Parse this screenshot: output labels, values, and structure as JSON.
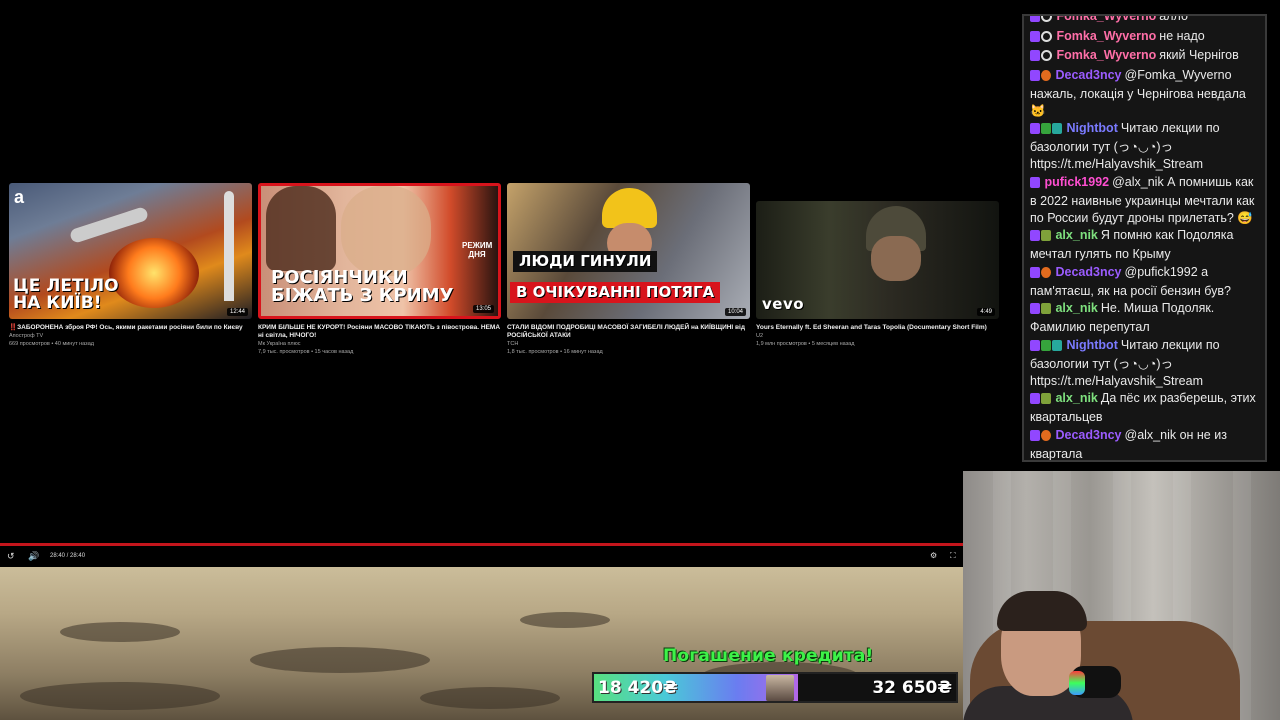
{
  "videos": [
    {
      "title": "‼️ЗАБОРОНЕНА зброя РФ! Ось, якими ракетами росіяни били по Києву",
      "channel": "Апостроф TV",
      "meta": "669 просмотров • 40 минут назад",
      "duration": "12:44",
      "overlay": "ЦЕ ЛЕТІЛО\nНА КИЇВ!"
    },
    {
      "title": "КРИМ БІЛЬШЕ НЕ КУРОРТ! Росіяни МАСОВО ТІКАЮТЬ з півострова. НЕМА ні світла, НІЧОГО!",
      "channel": "Мк Україна плюс",
      "meta": "7,9 тыс. просмотров • 15 часов назад",
      "duration": "13:05",
      "overlay": "РОСІЯНЧИКИ\nБІЖАТЬ З КРИМУ",
      "tag": "РЕЖИМ ДНЯ"
    },
    {
      "title": "СТАЛИ ВІДОМІ ПОДРОБИЦІ МАСОВОЇ ЗАГИБЕЛІ ЛЮДЕЙ на КИЇВЩИНІ від РОСІЙСЬКОЇ АТАКИ",
      "channel": "ТСН",
      "meta": "1,8 тыс. просмотров • 16 минут назад",
      "duration": "10:04",
      "overlay_top": "ЛЮДИ ГИНУЛИ",
      "overlay_bottom": "В ОЧІКУВАННІ ПОТЯГА"
    },
    {
      "title": "Yours Eternally ft. Ed Sheeran and Taras Topolia (Documentary Short Film)",
      "channel": "U2",
      "meta": "1,9 млн просмотров • 5 месяцев назад",
      "duration": "4:49",
      "overlay": "vevo"
    }
  ],
  "player": {
    "time": "28:40 / 28:40"
  },
  "credit": {
    "title": "Погашение кредита!",
    "current": "18 420₴",
    "goal": "32 650₴",
    "progress": 0.564
  },
  "chat": [
    {
      "nick": "Fomka_Wyverno",
      "color": "#ff6fa8",
      "badges": [
        "twitch",
        "ring"
      ],
      "text": "алло"
    },
    {
      "nick": "Fomka_Wyverno",
      "color": "#ff6fa8",
      "badges": [
        "twitch",
        "ring"
      ],
      "text": "не надо"
    },
    {
      "nick": "Fomka_Wyverno",
      "color": "#ff6fa8",
      "badges": [
        "twitch",
        "ring"
      ],
      "text": "який Чернігов"
    },
    {
      "nick": "Decad3ncy",
      "color": "#9b5cff",
      "badges": [
        "twitch",
        "orange"
      ],
      "text": "@Fomka_Wyverno нажаль, локація у Чернігова невдала 🐱"
    },
    {
      "nick": "Nightbot",
      "color": "#7b7bff",
      "badges": [
        "twitch",
        "pencil",
        "teal"
      ],
      "text": "Читаю лекции по базологии тут (っ◔◡◔)っ https://t.me/Halyavshik_Stream"
    },
    {
      "nick": "pufick1992",
      "color": "#ff4fd1",
      "badges": [
        "twitch"
      ],
      "text": "@alx_nik А помнишь как в 2022 наивные украинцы мечтали как по России будут дроны прилетать? 😅"
    },
    {
      "nick": "alx_nik",
      "color": "#7ee07e",
      "badges": [
        "twitch",
        "olive"
      ],
      "text": "Я помню как Подоляка мечтал гулять по Крыму"
    },
    {
      "nick": "Decad3ncy",
      "color": "#9b5cff",
      "badges": [
        "twitch",
        "orange"
      ],
      "text": "@pufick1992 а пам'ятаєш, як на росії бензин був?"
    },
    {
      "nick": "alx_nik",
      "color": "#7ee07e",
      "badges": [
        "twitch",
        "olive"
      ],
      "text": "Не. Миша Подоляк. Фамилию перепутал"
    },
    {
      "nick": "Nightbot",
      "color": "#7b7bff",
      "badges": [
        "twitch",
        "pencil",
        "teal"
      ],
      "text": "Читаю лекции по базологии тут (っ◔◡◔)っ https://t.me/Halyavshik_Stream"
    },
    {
      "nick": "alx_nik",
      "color": "#7ee07e",
      "badges": [
        "twitch",
        "olive"
      ],
      "text": "Да пёс их разберешь, этих квартальцев"
    },
    {
      "nick": "Decad3ncy",
      "color": "#9b5cff",
      "badges": [
        "twitch",
        "orange"
      ],
      "text": "@alx_nik он не из квартала"
    }
  ]
}
